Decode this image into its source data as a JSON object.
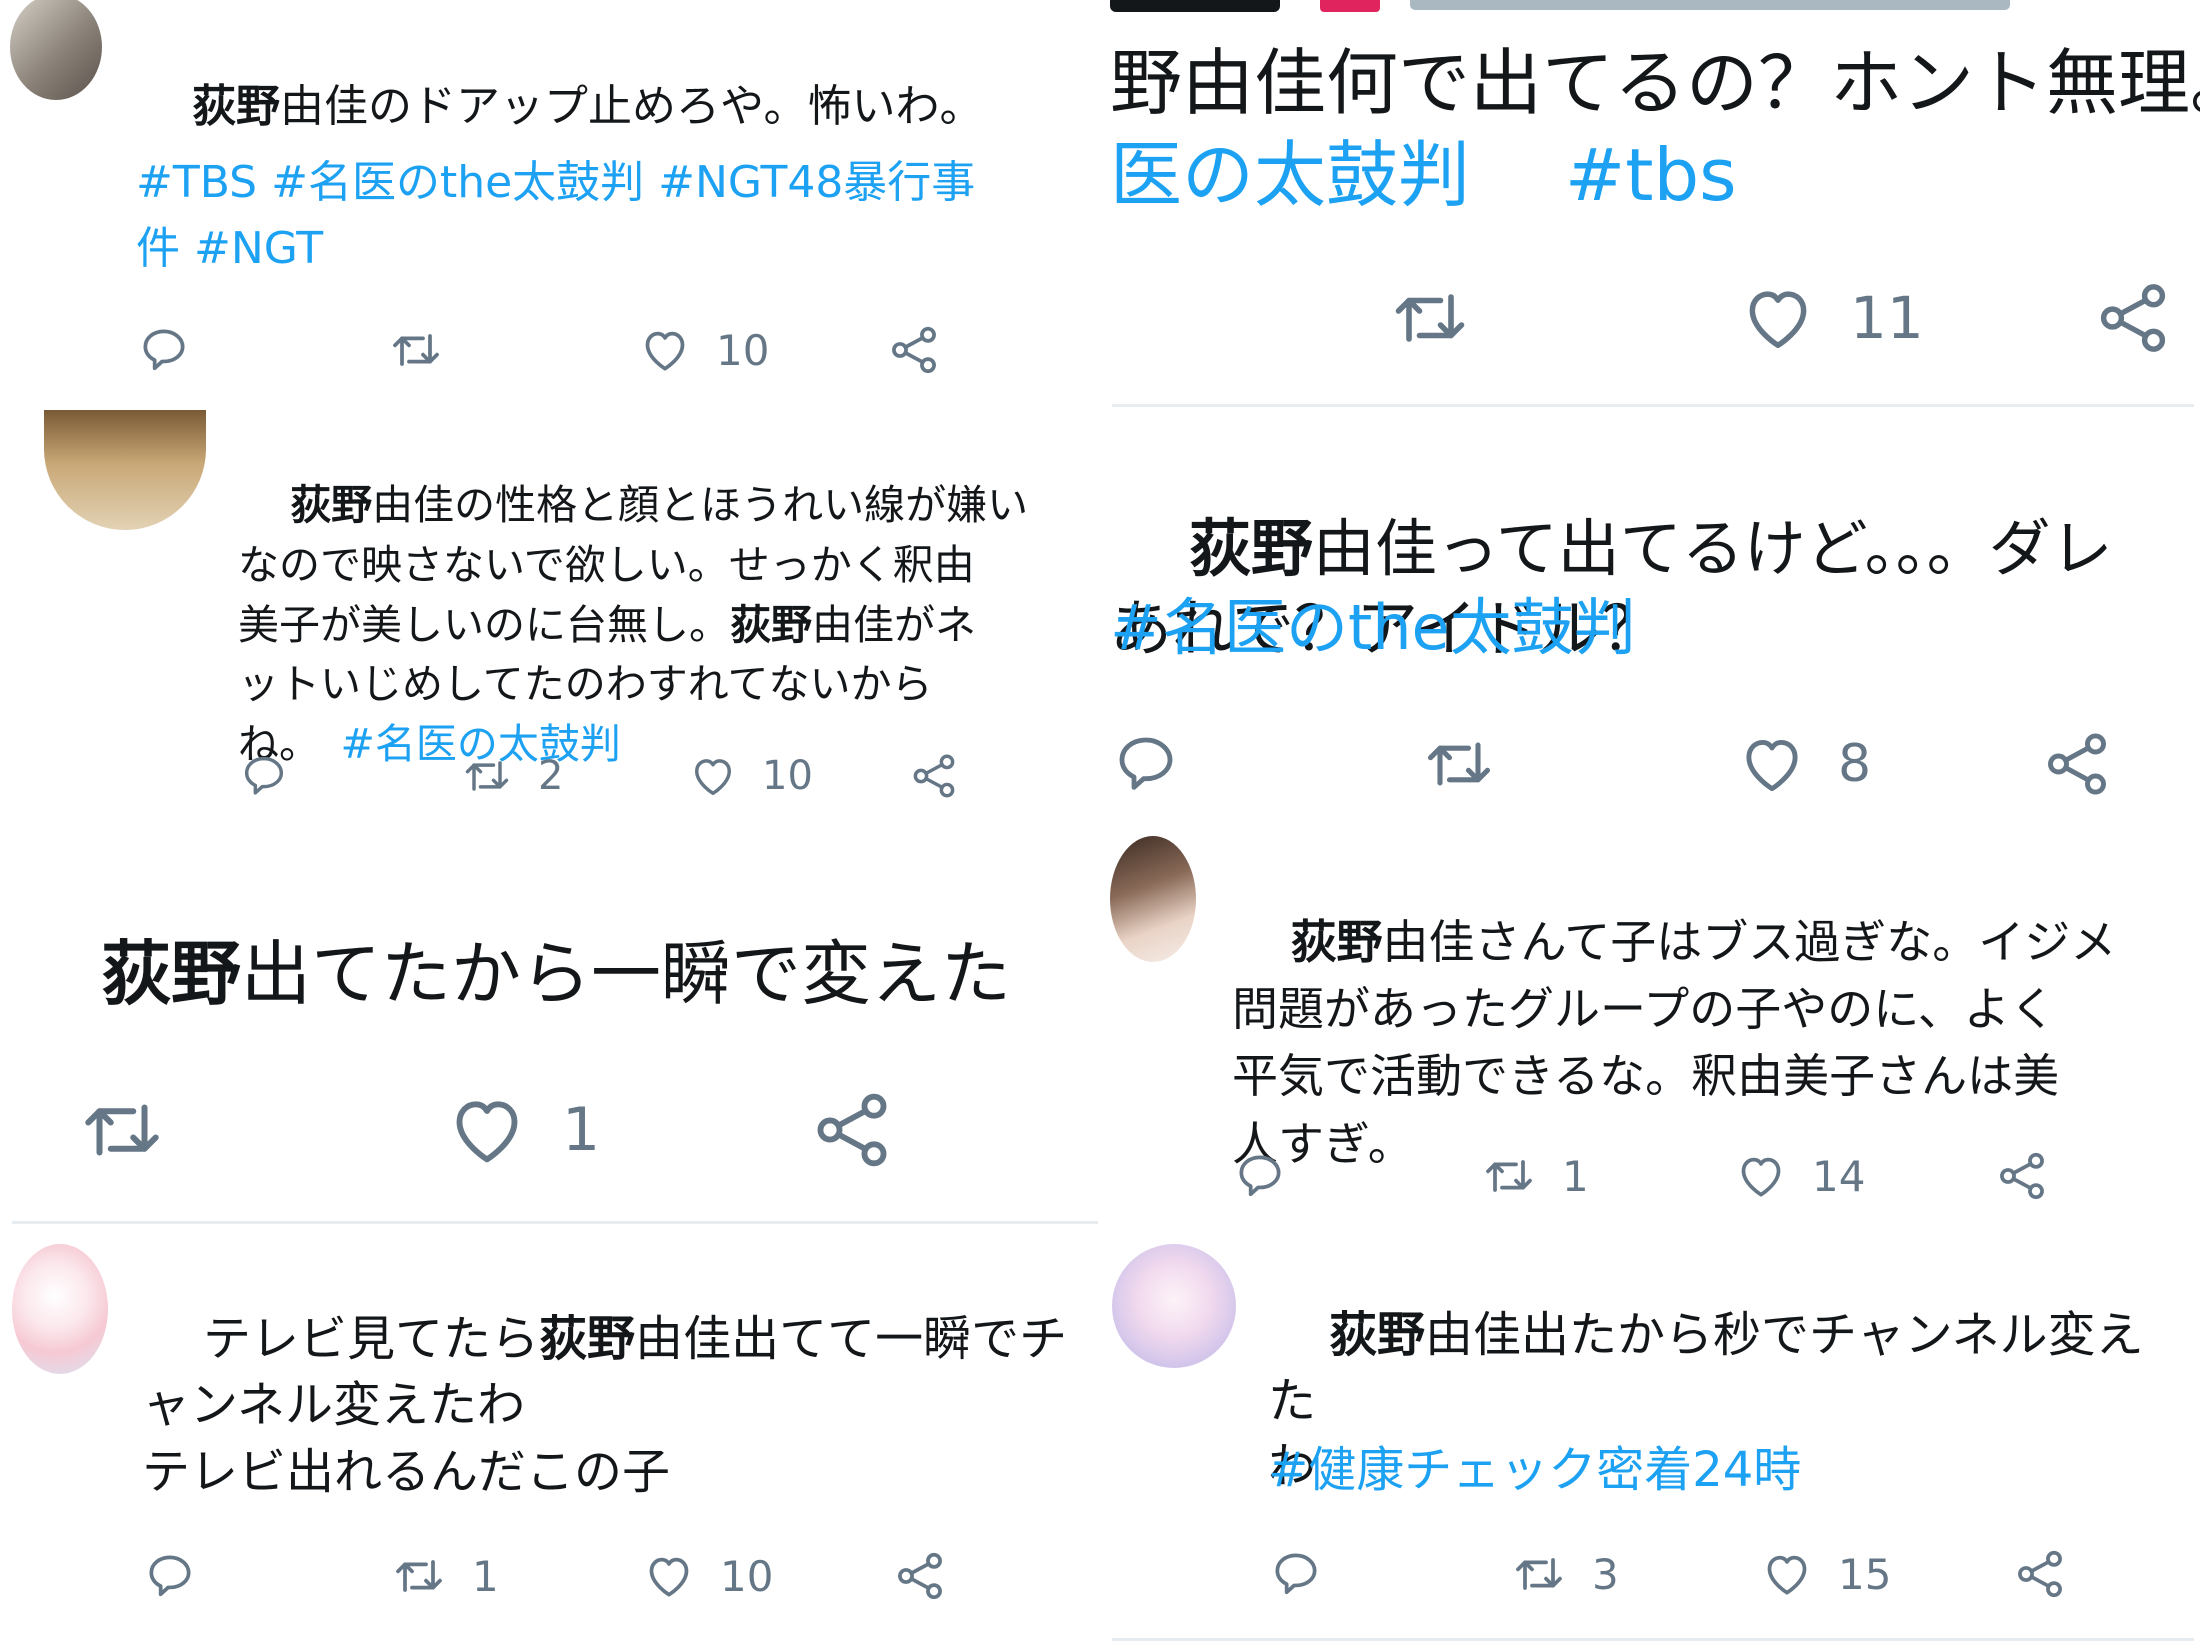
{
  "tweets": {
    "t1": {
      "text_kw": "荻野",
      "text_rest": "由佳のドアップ止めろや。怖いわ。",
      "tags": "#TBS #名医のthe太鼓判 #NGT48暴行事\n件 #NGT",
      "actions": {
        "reply": "",
        "retweet": "",
        "like": "10",
        "share": ""
      }
    },
    "t2": {
      "p1_kw": "荻野",
      "p1": "由佳の性格と顔とほうれい線が嫌い\nなので映さないで欲しい。せっかく釈由\n美子が美しいのに台無し。",
      "p2_kw": "荻野",
      "p2": "由佳がネ\nットいじめしてたのわすれてないから\nね。",
      "tag": "#名医の太鼓判",
      "actions": {
        "reply": "",
        "retweet": "2",
        "like": "10",
        "share": ""
      }
    },
    "t3": {
      "text_kw": "荻野",
      "text_rest": "出てたから一瞬で変えた",
      "actions": {
        "retweet": "",
        "like": "1",
        "share": ""
      }
    },
    "t4": {
      "l1": "テレビ見てたら",
      "l1_kw": "荻野",
      "l1_rest": "由佳出てて一瞬でチ\nャンネル変えたわ",
      "l2": "テレビ出れるんだこの子",
      "actions": {
        "reply": "",
        "retweet": "1",
        "like": "10",
        "share": ""
      }
    },
    "t5": {
      "header_fragment": "",
      "text": "野由佳何で出てるの？ホント無理。",
      "tags": "医の太鼓判　 #tbs",
      "actions": {
        "retweet": "",
        "like": "11",
        "share": ""
      }
    },
    "t6": {
      "text_kw": "荻野",
      "text_rest": "由佳って出てるけど。。。ダレ\nあれで？アイドル？",
      "tag": "#名医のthe太鼓判",
      "actions": {
        "reply": "",
        "retweet": "",
        "like": "8",
        "share": ""
      }
    },
    "t7": {
      "text_kw": "荻野",
      "text_rest": "由佳さんて子はブス過ぎな。イジメ\n問題があったグループの子やのに、よく\n平気で活動できるな。釈由美子さんは美\n人すぎ。",
      "actions": {
        "reply": "",
        "retweet": "1",
        "like": "14",
        "share": ""
      }
    },
    "t8": {
      "text_kw": "荻野",
      "text_rest": "由佳出たから秒でチャンネル変えた\nわ",
      "tag": "#健康チェック密着24時",
      "actions": {
        "reply": "",
        "retweet": "3",
        "like": "15",
        "share": ""
      }
    }
  },
  "colors": {
    "hashtag": "#1da1f2",
    "icon": "#657786",
    "text": "#14171a",
    "separator": "#e6ecf0"
  },
  "icons": [
    "reply-icon",
    "retweet-icon",
    "heart-icon",
    "share-icon",
    "avatar"
  ]
}
